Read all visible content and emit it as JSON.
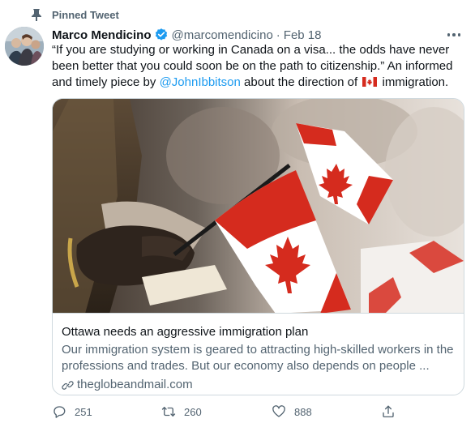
{
  "pinned": {
    "label": "Pinned Tweet",
    "icon": "pin-icon"
  },
  "author": {
    "name": "Marco Mendicino",
    "verified": true,
    "handle": "@marcomendicino",
    "separator": "·",
    "date": "Feb 18"
  },
  "tweet": {
    "text_1": "“If you are studying or working in Canada on a visa... the odds have never been better that you could soon be on the path to citizenship.” An informed and timely piece by ",
    "mention": "@JohnIbbitson",
    "text_2": " about the direction of ",
    "emoji": "canada-flag-emoji",
    "text_3": " immigration."
  },
  "card": {
    "image": "canadian-flags-citizenship-ceremony-photo",
    "title": "Ottawa needs an aggressive immigration plan",
    "description": "Our immigration system is geared to attracting high-skilled workers in the professions and trades. But our economy also depends on people ...",
    "domain": "theglobeandmail.com"
  },
  "actions": {
    "reply_count": "251",
    "retweet_count": "260",
    "like_count": "888"
  },
  "colors": {
    "accent": "#1d9bf0",
    "secondary_text": "#536471",
    "border": "#cfd9de",
    "flag_red": "#d52b1e"
  }
}
